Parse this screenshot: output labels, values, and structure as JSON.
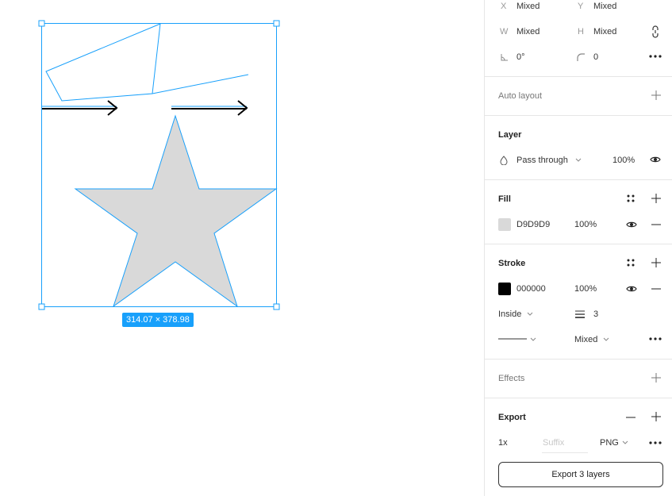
{
  "canvas": {
    "selection_size": "314.07 × 378.98",
    "star_fill": "#D9D9D9",
    "selection_color": "#18A0FB"
  },
  "position": {
    "x_label": "X",
    "x_value": "Mixed",
    "y_label": "Y",
    "y_value": "Mixed",
    "w_label": "W",
    "w_value": "Mixed",
    "h_label": "H",
    "h_value": "Mixed",
    "rotation_value": "0°",
    "radius_value": "0"
  },
  "auto_layout": {
    "title": "Auto layout"
  },
  "layer": {
    "title": "Layer",
    "blend_mode": "Pass through",
    "opacity": "100%"
  },
  "fill": {
    "title": "Fill",
    "hex": "D9D9D9",
    "opacity": "100%",
    "color": "#D9D9D9"
  },
  "stroke": {
    "title": "Stroke",
    "hex": "000000",
    "opacity": "100%",
    "color": "#000000",
    "position": "Inside",
    "weight": "3",
    "style_value": "Mixed"
  },
  "effects": {
    "title": "Effects"
  },
  "export": {
    "title": "Export",
    "scale": "1x",
    "suffix_placeholder": "Suffix",
    "format": "PNG",
    "button_label": "Export 3 layers"
  }
}
